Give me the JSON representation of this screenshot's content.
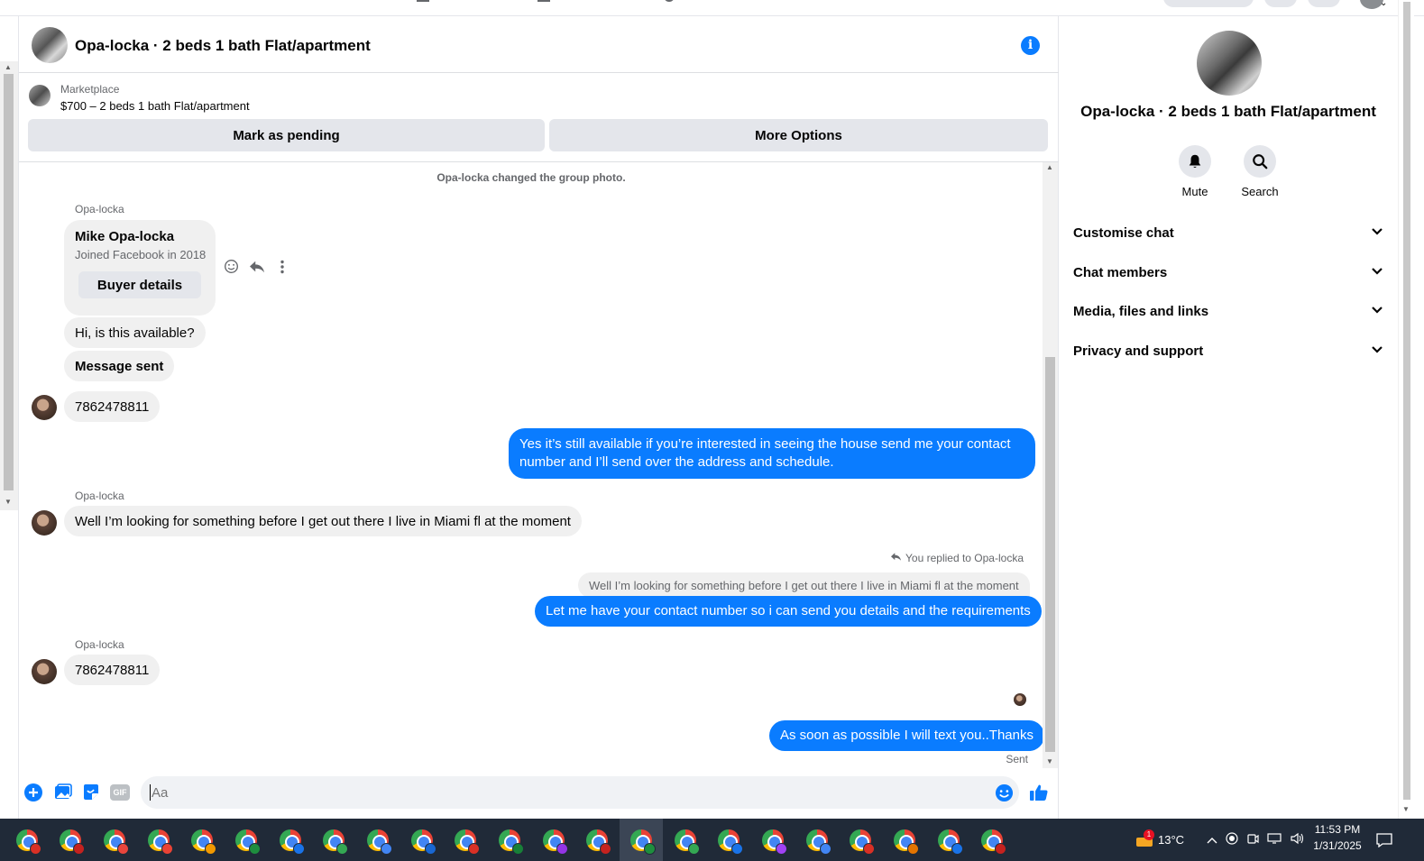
{
  "header": {
    "title": "Opa-locka · 2 beds 1 bath Flat/apartment"
  },
  "listing": {
    "source": "Marketplace",
    "price_line": "$700 – 2 beds 1 bath Flat/apartment",
    "mark_pending_label": "Mark as pending",
    "more_options_label": "More Options"
  },
  "messages": {
    "system_notice": "Opa-locka changed the group photo.",
    "sender_name": "Opa-locka",
    "buyer_card": {
      "name": "Mike Opa-locka",
      "joined": "Joined Facebook in 2018",
      "button_label": "Buyer details"
    },
    "in_1": "Hi, is this available?",
    "in_2": "Message sent",
    "in_3": "7862478811",
    "out_1_line1": "Yes it’s still available if you’re interested in seeing the house send me your contact",
    "out_1_line2": "number and I’ll send over the address and schedule.",
    "in_4": "Well I’m looking for something before I get out there I live in Miami fl at the moment",
    "replied_label": "You replied to Opa-locka",
    "quoted_text": "Well I’m looking for something before I get out there I live in Miami fl at the moment",
    "out_2": "Let me have your contact number so i can send you details and the requirements",
    "in_5": "7862478811",
    "out_3": "As soon as possible I will text you..Thanks",
    "status": "Sent"
  },
  "composer": {
    "placeholder": "Aa",
    "gif_label": "GIF"
  },
  "right_panel": {
    "title": "Opa-locka · 2 beds 1 bath Flat/apartment",
    "mute_label": "Mute",
    "search_label": "Search",
    "sections": [
      "Customise chat",
      "Chat members",
      "Media, files and links",
      "Privacy and support"
    ]
  },
  "taskbar": {
    "temperature": "13°C",
    "time": "11:53 PM",
    "date": "1/31/2025",
    "weather_badge": "1"
  },
  "colors": {
    "accent": "#0a7cff",
    "bubble_in": "#f0f0f0",
    "taskbar": "#202a38"
  }
}
